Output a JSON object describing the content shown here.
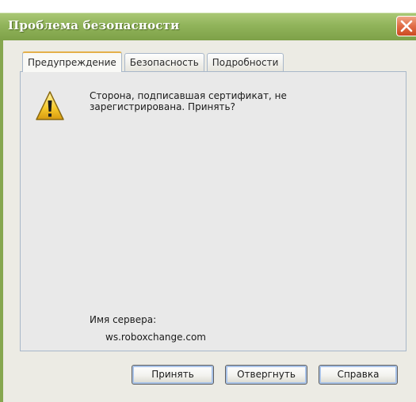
{
  "window": {
    "title": "Проблема безопасности"
  },
  "tabs": [
    {
      "label": "Предупреждение",
      "active": true
    },
    {
      "label": "Безопасность",
      "active": false
    },
    {
      "label": "Подробности",
      "active": false
    }
  ],
  "warning": {
    "icon": "warning-icon",
    "message_line1": "Сторона, подписавшая сертификат, не",
    "message_line2": "зарегистрирована. Принять?"
  },
  "server": {
    "label": "Имя сервера:",
    "value": "ws.roboxchange.com"
  },
  "buttons": {
    "accept": "Принять",
    "reject": "Отвергнуть",
    "help": "Справка"
  },
  "colors": {
    "titlebar": "#90b35a",
    "close": "#e06c45",
    "tab_active_accent": "#e4b04a",
    "panel": "#e9e9e9"
  }
}
